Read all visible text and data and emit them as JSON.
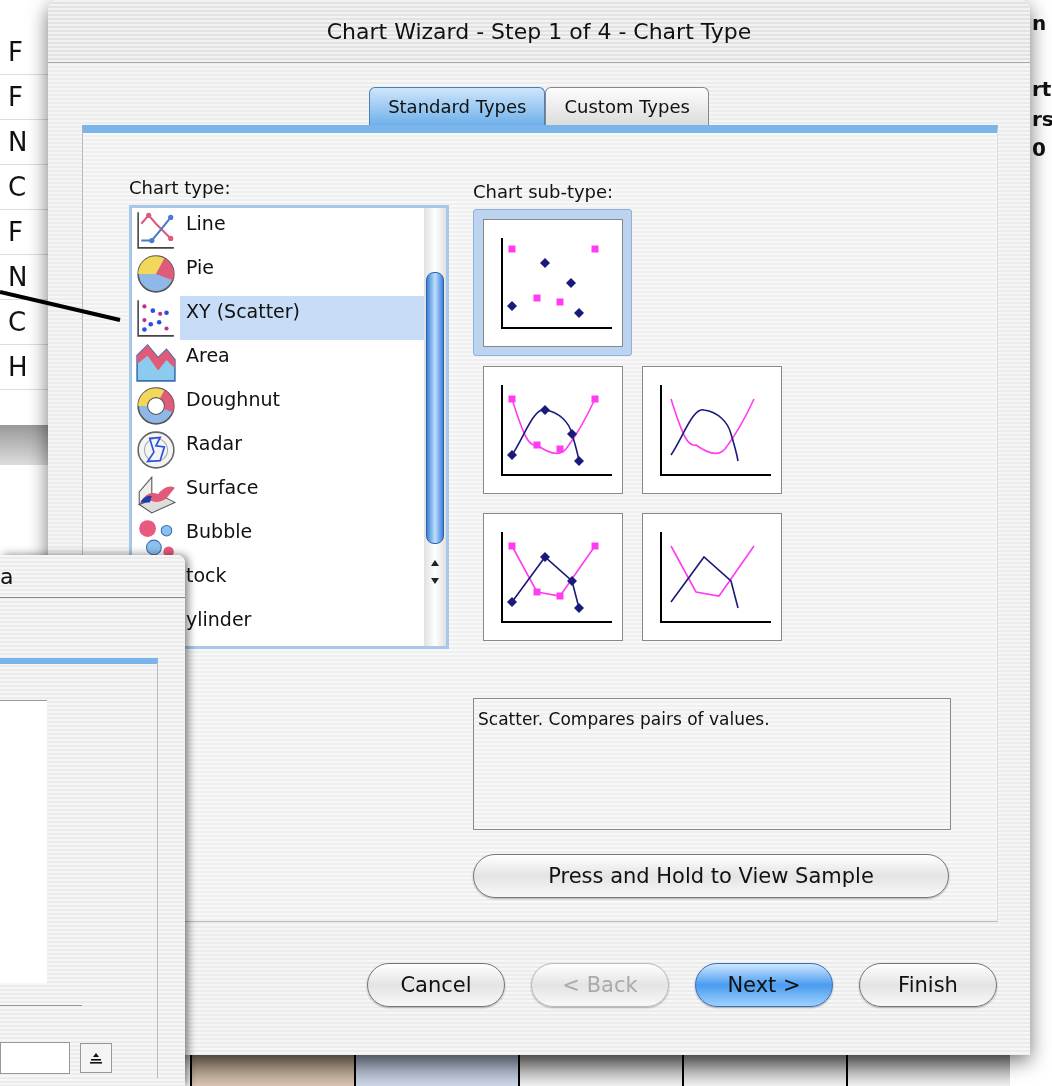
{
  "background_sheet": {
    "left_cells": [
      "F",
      "F",
      "N",
      "C",
      "F",
      "N",
      "C",
      "H"
    ],
    "right_cells": [
      "n",
      "rt",
      "rs",
      "0"
    ]
  },
  "back_dialog": {
    "title": "a"
  },
  "window": {
    "title": "Chart Wizard - Step 1 of 4 - Chart Type"
  },
  "tabs": [
    {
      "label": "Standard Types",
      "selected": true
    },
    {
      "label": "Custom Types",
      "selected": false
    }
  ],
  "chart_type": {
    "label": "Chart type:",
    "items": [
      {
        "label": "Line",
        "kind": "line",
        "selected": false
      },
      {
        "label": "Pie",
        "kind": "pie",
        "selected": false
      },
      {
        "label": "XY (Scatter)",
        "kind": "scatter",
        "selected": true
      },
      {
        "label": "Area",
        "kind": "area",
        "selected": false
      },
      {
        "label": "Doughnut",
        "kind": "doughnut",
        "selected": false
      },
      {
        "label": "Radar",
        "kind": "radar",
        "selected": false
      },
      {
        "label": "Surface",
        "kind": "surface",
        "selected": false
      },
      {
        "label": "Bubble",
        "kind": "bubble",
        "selected": false
      },
      {
        "label": "tock",
        "selected": false
      },
      {
        "label": "ylinder",
        "selected": false
      }
    ]
  },
  "sub_type": {
    "label": "Chart sub-type:",
    "items": [
      {
        "kind": "markers",
        "selected": true
      },
      {
        "kind": "smooth-markers",
        "selected": false
      },
      {
        "kind": "smooth",
        "selected": false
      },
      {
        "kind": "line-markers",
        "selected": false
      },
      {
        "kind": "line",
        "selected": false
      }
    ]
  },
  "description": "Scatter. Compares pairs of values.",
  "sample_button": "Press and Hold to View Sample",
  "buttons": [
    {
      "label": "Cancel",
      "disabled": false,
      "default": false
    },
    {
      "label": "< Back",
      "disabled": true,
      "default": false
    },
    {
      "label": "Next >",
      "disabled": false,
      "default": true
    },
    {
      "label": "Finish",
      "disabled": false,
      "default": false
    }
  ]
}
